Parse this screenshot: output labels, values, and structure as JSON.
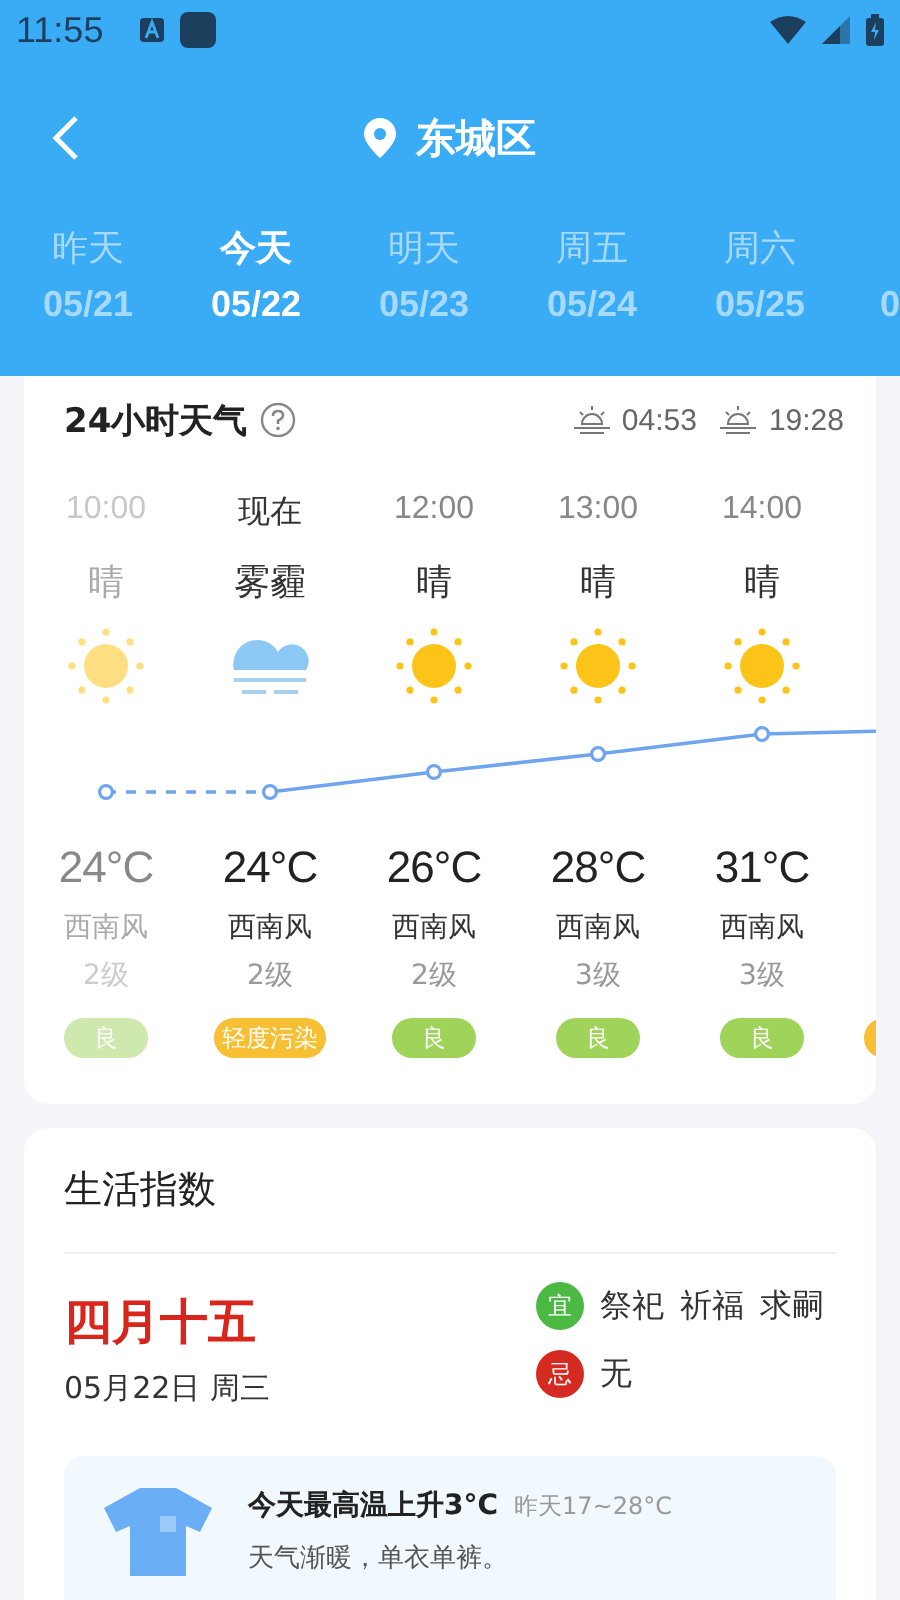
{
  "status_bar": {
    "time": "11:55"
  },
  "header": {
    "location": "东城区"
  },
  "tabs": [
    {
      "day": "昨天",
      "date": "05/21",
      "selected": false
    },
    {
      "day": "今天",
      "date": "05/22",
      "selected": true
    },
    {
      "day": "明天",
      "date": "05/23",
      "selected": false
    },
    {
      "day": "周五",
      "date": "05/24",
      "selected": false
    },
    {
      "day": "周六",
      "date": "05/25",
      "selected": false
    },
    {
      "date": "0",
      "selected": false
    }
  ],
  "hourly": {
    "title": "24小时天气",
    "sunrise": "04:53",
    "sunset": "19:28",
    "items": [
      {
        "time": "10:00",
        "condition": "晴",
        "kind": "sunny",
        "temp": "24°C",
        "wind": "西南风",
        "level": "2级",
        "aqi": "良",
        "color": "#cfe8ad",
        "past": true
      },
      {
        "time": "现在",
        "condition": "雾霾",
        "kind": "haze",
        "temp": "24°C",
        "wind": "西南风",
        "level": "2级",
        "aqi": "轻度污染",
        "color": "#f7bf33",
        "past": false,
        "now": true
      },
      {
        "time": "12:00",
        "condition": "晴",
        "kind": "sunny",
        "temp": "26°C",
        "wind": "西南风",
        "level": "2级",
        "aqi": "良",
        "color": "#9fd35a",
        "past": false
      },
      {
        "time": "13:00",
        "condition": "晴",
        "kind": "sunny",
        "temp": "28°C",
        "wind": "西南风",
        "level": "3级",
        "aqi": "良",
        "color": "#9fd35a",
        "past": false
      },
      {
        "time": "14:00",
        "condition": "晴",
        "kind": "sunny",
        "temp": "31°C",
        "wind": "西南风",
        "level": "3级",
        "aqi": "良",
        "color": "#9fd35a",
        "past": false
      },
      {
        "color": "#f7bf33"
      }
    ]
  },
  "life": {
    "title": "生活指数",
    "lunar": "四月十五",
    "date": "05月22日 周三",
    "good": {
      "mark": "宜",
      "items": [
        "祭祀",
        "祈福",
        "求嗣"
      ]
    },
    "bad": {
      "mark": "忌",
      "items": [
        "无"
      ]
    },
    "tip": {
      "title": "今天最高温上升3°C",
      "compare": "昨天17~28°C",
      "text": "天气渐暖，单衣单裤。"
    }
  }
}
